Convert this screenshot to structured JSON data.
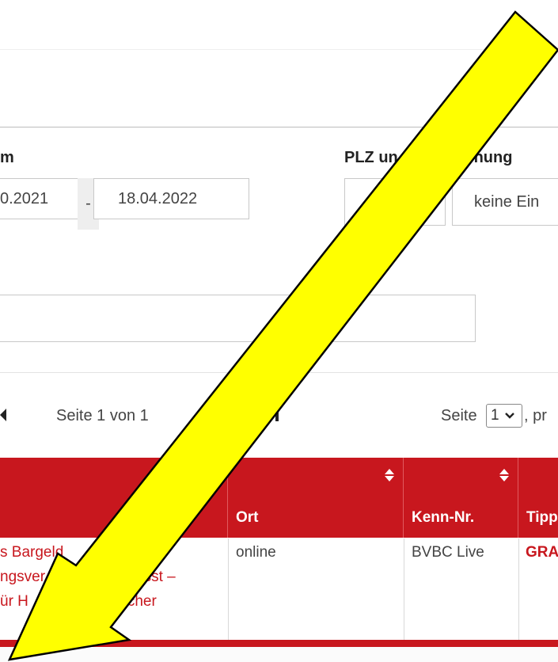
{
  "filters": {
    "date_label": "m",
    "date_from": "0.2021",
    "date_separator": "-",
    "date_to": "18.04.2022",
    "plz_label": "PLZ un",
    "plz_label_tail": "fernung",
    "distance_value": "keine Ein"
  },
  "pager": {
    "page_info": "Seite 1 von 1",
    "page_select_prefix": "Seite",
    "page_select_value": "1",
    "page_select_suffix": ", pr"
  },
  "table": {
    "columns": [
      {
        "label": ""
      },
      {
        "label": "Ort"
      },
      {
        "label": "Kenn-Nr."
      },
      {
        "label": "Tipp"
      }
    ],
    "row1": {
      "title_line1": "s Bargeld",
      "title_line1b": "die",
      "title_line2": "ngsver",
      "title_line2b": "beeinflusst –",
      "title_line3": "ür H",
      "title_line3b": "nd Verbraucher",
      "ort": "online",
      "kenn": "BVBC Live",
      "tipp": "GRA"
    }
  },
  "colors": {
    "header_red": "#c8171e",
    "arrow_yellow": "#ffff00"
  },
  "icons": [
    "first-page-icon",
    "last-page-icon",
    "sort-icon",
    "chevron-down-icon",
    "arrow-annotation"
  ]
}
